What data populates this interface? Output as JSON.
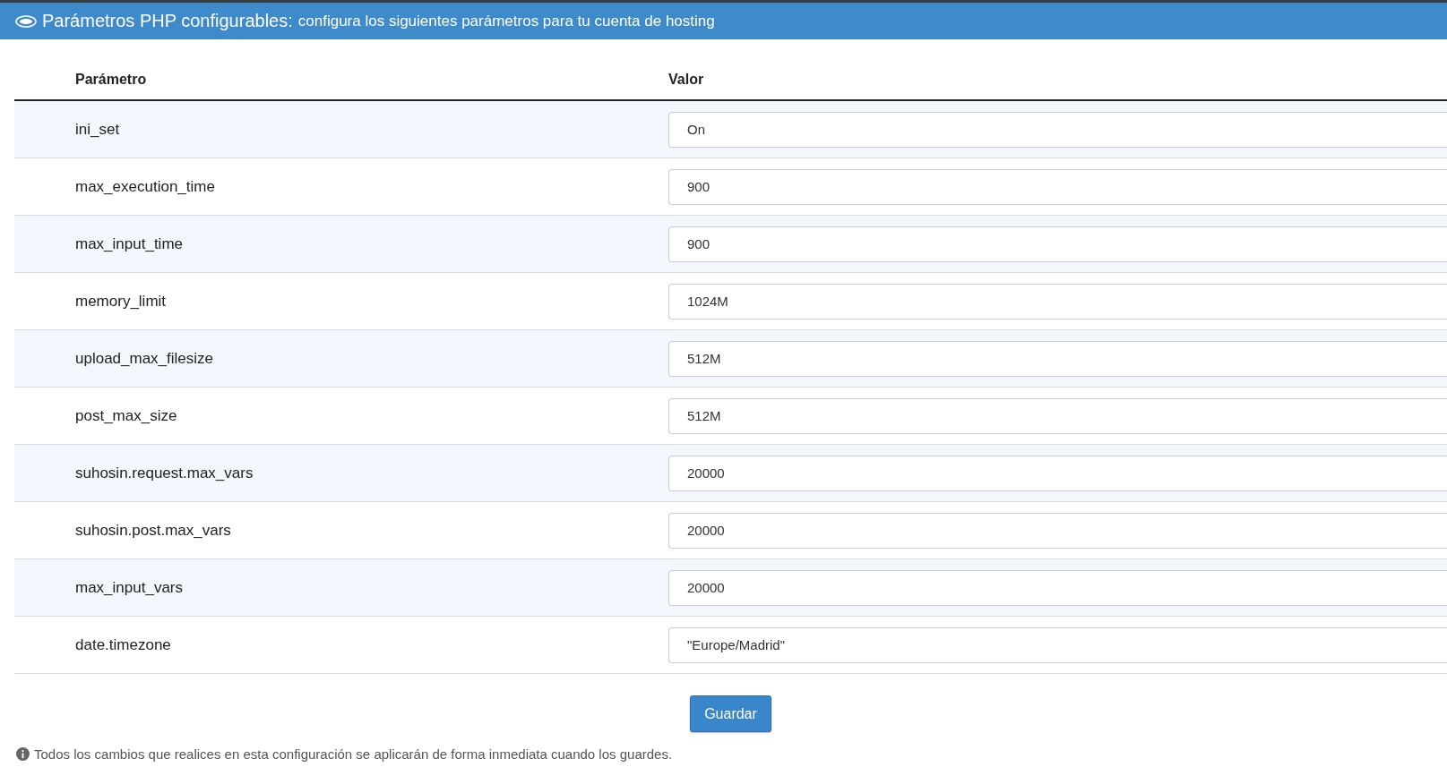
{
  "header": {
    "title": "Parámetros PHP configurables:",
    "subtitle": "configura los siguientes parámetros para tu cuenta de hosting"
  },
  "table": {
    "columns": [
      "Parámetro",
      "Valor"
    ],
    "rows": [
      {
        "name": "ini_set",
        "value": "On"
      },
      {
        "name": "max_execution_time",
        "value": "900"
      },
      {
        "name": "max_input_time",
        "value": "900"
      },
      {
        "name": "memory_limit",
        "value": "1024M"
      },
      {
        "name": "upload_max_filesize",
        "value": "512M"
      },
      {
        "name": "post_max_size",
        "value": "512M"
      },
      {
        "name": "suhosin.request.max_vars",
        "value": "20000"
      },
      {
        "name": "suhosin.post.max_vars",
        "value": "20000"
      },
      {
        "name": "max_input_vars",
        "value": "20000"
      },
      {
        "name": "date.timezone",
        "value": "\"Europe/Madrid\""
      }
    ]
  },
  "save_button": "Guardar",
  "note": "Todos los cambios que realices en esta configuración se aplicarán de forma inmediata cuando los guardes."
}
